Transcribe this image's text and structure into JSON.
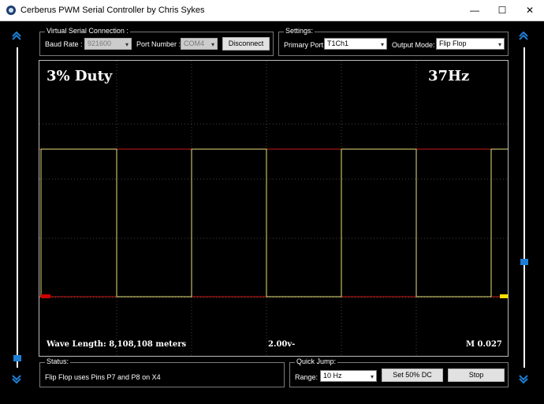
{
  "window": {
    "title": "Cerberus PWM Serial Controller by Chris Sykes",
    "minimize": "—",
    "maximize": "☐",
    "close": "✕"
  },
  "serial": {
    "legend": "Virtual Serial Connection :",
    "baud_label": "Baud Rate :",
    "baud_value": "921600",
    "port_label": "Port Number :",
    "port_value": "COM4",
    "disconnect_label": "Disconnect"
  },
  "settings": {
    "legend": "Settings:",
    "primary_port_label": "Primary Port:",
    "primary_port_value": "T1Ch1",
    "output_mode_label": "Output Mode:",
    "output_mode_value": "Flip Flop"
  },
  "scope": {
    "duty": "3% Duty",
    "frequency": "37Hz",
    "wave_length": "Wave Length: 8,108,108 meters",
    "volts": "2.00v-",
    "marker": "M 0.027",
    "colors": {
      "wave": "#e8e07a",
      "ref_line": "#cc1a1a",
      "grid": "#444444",
      "left_marker": "#cc0000",
      "right_marker": "#ffe000"
    }
  },
  "sliders": {
    "left_level": 0.97,
    "right_level": 0.67,
    "up_icon": "chevron-up-icon",
    "down_icon": "chevron-down-icon",
    "color": "#1e7fd6"
  },
  "status": {
    "legend": "Status:",
    "text": "Flip Flop uses Pins P7 and P8 on X4"
  },
  "quick_jump": {
    "legend": "Quick Jump:",
    "range_label": "Range:",
    "range_value": "10 Hz",
    "set50_label": "Set 50% DC",
    "stop_label": "Stop"
  }
}
